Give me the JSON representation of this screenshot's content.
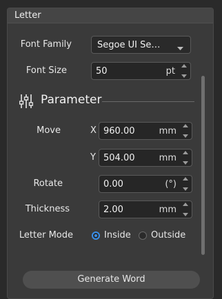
{
  "panel": {
    "title": "Letter"
  },
  "font_family": {
    "label": "Font Family",
    "value": "Segoe UI Se…"
  },
  "font_size": {
    "label": "Font Size",
    "value": "50",
    "unit": "pt"
  },
  "parameter": {
    "title": "Parameter",
    "icon": "sliders-icon"
  },
  "move": {
    "label": "Move",
    "x": {
      "axis": "X",
      "value": "960.00",
      "unit": "mm"
    },
    "y": {
      "axis": "Y",
      "value": "504.00",
      "unit": "mm"
    }
  },
  "rotate": {
    "label": "Rotate",
    "value": "0.00",
    "unit": "(°)"
  },
  "thickness": {
    "label": "Thickness",
    "value": "2.00",
    "unit": "mm"
  },
  "letter_mode": {
    "label": "Letter Mode",
    "options": [
      {
        "label": "Inside",
        "selected": true
      },
      {
        "label": "Outside",
        "selected": false
      }
    ]
  },
  "actions": {
    "generate_label": "Generate Word"
  },
  "colors": {
    "accent": "#3a8ee6",
    "panel": "#3a3a3a",
    "field": "#262626"
  }
}
